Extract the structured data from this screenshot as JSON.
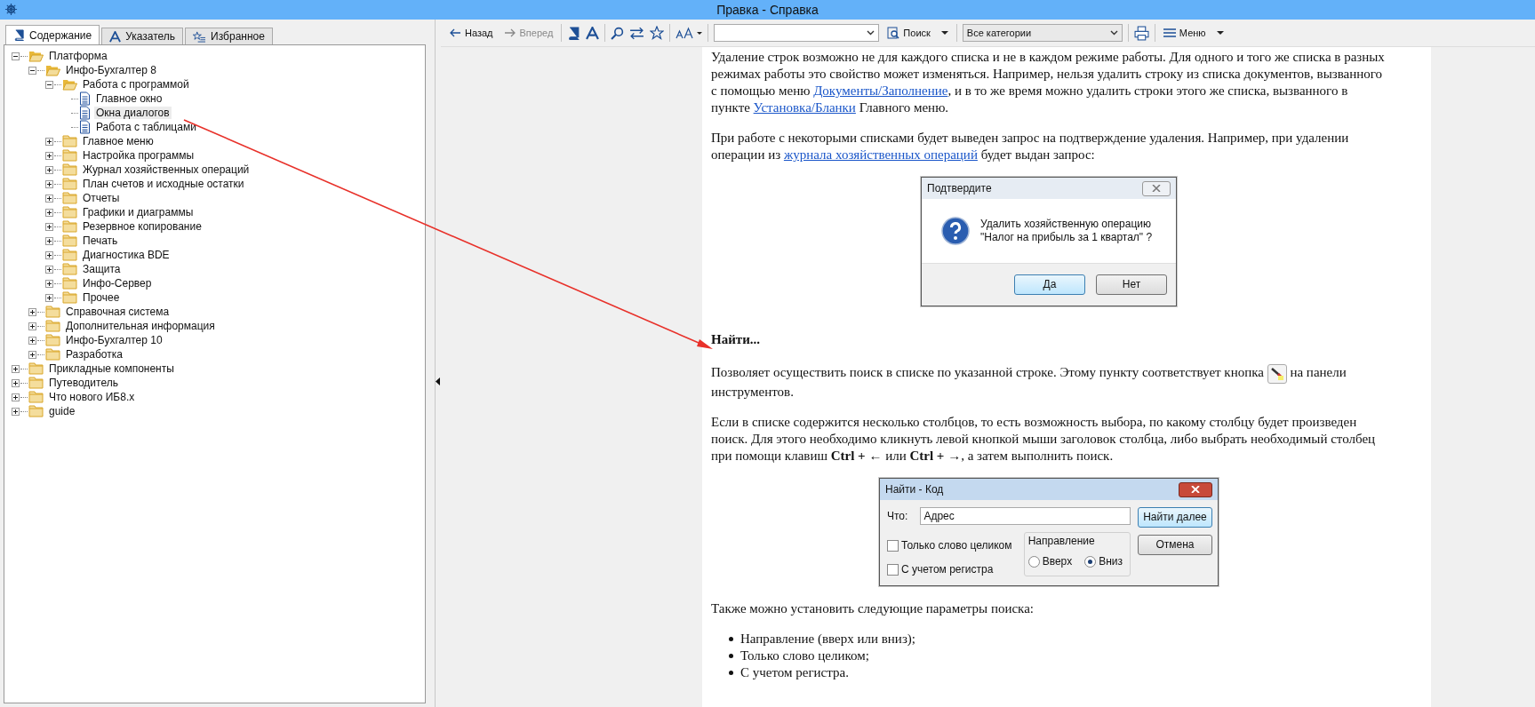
{
  "window": {
    "title": "Правка - Справка"
  },
  "tabs": [
    {
      "label": "Содержание",
      "selected": true
    },
    {
      "label": "Указатель",
      "selected": false
    },
    {
      "label": "Избранное",
      "selected": false
    }
  ],
  "tree": [
    {
      "label": "Платформа",
      "kind": "folder",
      "expanded": true,
      "selected": false,
      "children": [
        {
          "label": "Инфо-Бухгалтер 8",
          "kind": "folder",
          "expanded": true,
          "selected": false,
          "children": [
            {
              "label": "Работа с программой",
              "kind": "folder",
              "expanded": true,
              "selected": false,
              "children": [
                {
                  "label": "Главное окно",
                  "kind": "page",
                  "selected": false
                },
                {
                  "label": "Окна диалогов",
                  "kind": "page",
                  "selected": true
                },
                {
                  "label": "Работа с таблицами",
                  "kind": "page",
                  "selected": false
                }
              ]
            },
            {
              "label": "Главное меню",
              "kind": "folder",
              "expanded": false,
              "selected": false
            },
            {
              "label": "Настройка программы",
              "kind": "folder",
              "expanded": false,
              "selected": false
            },
            {
              "label": "Журнал хозяйственных операций",
              "kind": "folder",
              "expanded": false,
              "selected": false
            },
            {
              "label": "План счетов и исходные остатки",
              "kind": "folder",
              "expanded": false,
              "selected": false
            },
            {
              "label": "Отчеты",
              "kind": "folder",
              "expanded": false,
              "selected": false
            },
            {
              "label": "Графики и диаграммы",
              "kind": "folder",
              "expanded": false,
              "selected": false
            },
            {
              "label": "Резервное копирование",
              "kind": "folder",
              "expanded": false,
              "selected": false
            },
            {
              "label": "Печать",
              "kind": "folder",
              "expanded": false,
              "selected": false
            },
            {
              "label": "Диагностика BDE",
              "kind": "folder",
              "expanded": false,
              "selected": false
            },
            {
              "label": "Защита",
              "kind": "folder",
              "expanded": false,
              "selected": false
            },
            {
              "label": "Инфо-Сервер",
              "kind": "folder",
              "expanded": false,
              "selected": false
            },
            {
              "label": "Прочее",
              "kind": "folder",
              "expanded": false,
              "selected": false
            }
          ]
        },
        {
          "label": "Справочная система",
          "kind": "folder",
          "expanded": false,
          "selected": false
        },
        {
          "label": "Дополнительная информация",
          "kind": "folder",
          "expanded": false,
          "selected": false
        },
        {
          "label": "Инфо-Бухгалтер 10",
          "kind": "folder",
          "expanded": false,
          "selected": false
        },
        {
          "label": "Разработка",
          "kind": "folder",
          "expanded": false,
          "selected": false
        }
      ]
    },
    {
      "label": "Прикладные компоненты",
      "kind": "folder",
      "expanded": false,
      "selected": false
    },
    {
      "label": "Путеводитель",
      "kind": "folder",
      "expanded": false,
      "selected": false
    },
    {
      "label": "Что нового ИБ8.x",
      "kind": "folder",
      "expanded": false,
      "selected": false
    },
    {
      "label": "guide",
      "kind": "folder",
      "expanded": false,
      "selected": false
    }
  ],
  "toolbar": {
    "back": {
      "label": "Назад",
      "disabled": false
    },
    "forward": {
      "label": "Вперед",
      "disabled": true
    },
    "search_button": "Поиск",
    "category": "Все категории",
    "menu": "Меню"
  },
  "content": [
    {
      "kind": "paragraph",
      "parts": [
        {
          "kind": "text",
          "text": "Удаление строк возможно не для каждого списка и не в каждом режиме работы. Для одного и того же списка в разных режимах работы это свойство может изменяться. Например, нельзя удалить строку из списка документов, вызванного с помощью меню "
        },
        {
          "kind": "link",
          "text": "Документы/Заполнение"
        },
        {
          "kind": "text",
          "text": ", и в то же время можно удалить строки этого же списка, вызванного в пункте "
        },
        {
          "kind": "link",
          "text": "Установка/Бланки"
        },
        {
          "kind": "text",
          "text": " Главного меню."
        }
      ]
    },
    {
      "kind": "paragraph",
      "parts": [
        {
          "kind": "text",
          "text": "При работе с некоторыми списками будет выведен запрос на подтверждение удаления. Например, при удалении операции из "
        },
        {
          "kind": "link",
          "text": "журнала хозяйственных операций"
        },
        {
          "kind": "text",
          "text": " будет выдан запрос:"
        }
      ]
    },
    {
      "kind": "confirm_dialog",
      "title": "Подтвердите",
      "message": [
        "Удалить хозяйственную операцию",
        "\"Налог на прибыль за 1 квартал\" ?"
      ],
      "buttons": [
        {
          "label": "Да",
          "default": true
        },
        {
          "label": "Нет",
          "default": false
        }
      ]
    },
    {
      "kind": "heading",
      "text": "Найти..."
    },
    {
      "kind": "paragraph",
      "parts": [
        {
          "kind": "text",
          "text": "Позволяет осуществить поиск в списке по указанной строке. Этому пункту соответствует кнопка "
        },
        {
          "kind": "icon"
        },
        {
          "kind": "text",
          "text": " на панели инструментов."
        }
      ]
    },
    {
      "kind": "paragraph",
      "parts": [
        {
          "kind": "text",
          "text": "Если в списке содержится несколько столбцов, то есть возможность выбора, по какому столбцу будет произведен поиск. Для этого необходимо кликнуть левой кнопкой мыши заголовок столбца, либо выбрать необходимый столбец при помощи клавиш **Ctrl +** ← или **Ctrl +** →, а затем выполнить поиск."
        }
      ]
    },
    {
      "kind": "find_dialog",
      "title": "Найти - Код",
      "field_label": "Что:",
      "field_value": "Адрес",
      "checkboxes": [
        {
          "label": "Только слово целиком",
          "checked": false
        },
        {
          "label": "С учетом регистра",
          "checked": false
        }
      ],
      "group": "Направление",
      "radios": [
        {
          "label": "Вверх",
          "selected": false
        },
        {
          "label": "Вниз",
          "selected": true
        }
      ],
      "buttons": [
        {
          "label": "Найти далее",
          "default": true
        },
        {
          "label": "Отмена",
          "default": false
        }
      ]
    },
    {
      "kind": "paragraph",
      "parts": [
        {
          "kind": "text",
          "text": "Также можно установить следующие параметры поиска:"
        }
      ]
    },
    {
      "kind": "list",
      "items": [
        "Направление (вверх или вниз);",
        "Только слово целиком;",
        "С учетом регистра."
      ]
    }
  ]
}
